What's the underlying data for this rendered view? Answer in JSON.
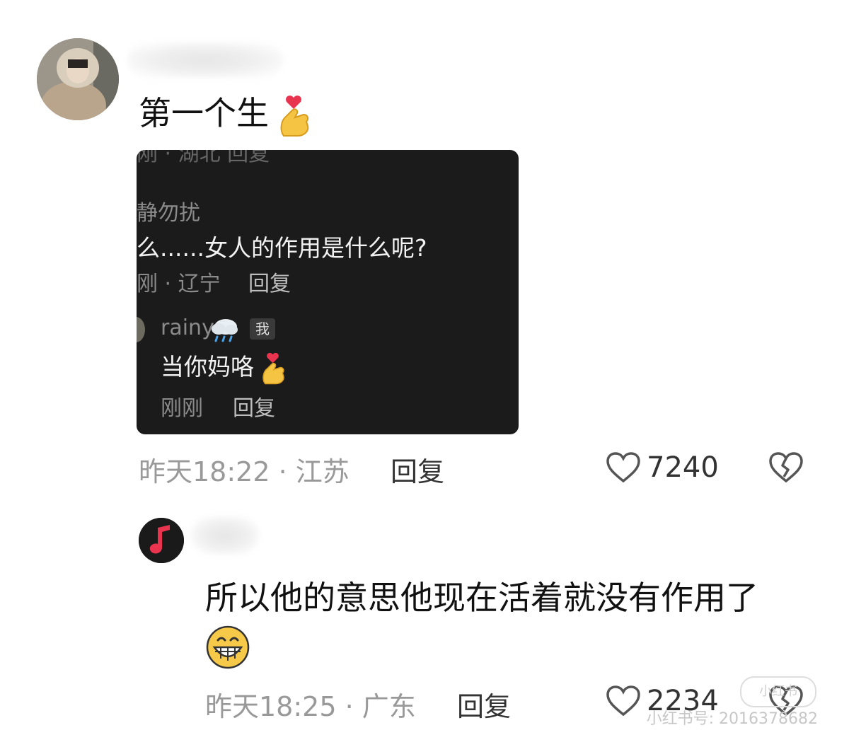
{
  "comment1": {
    "text": "第一个生",
    "time_location": "昨天18:22 · 江苏",
    "reply_label": "回复",
    "like_count": "7240"
  },
  "embedded": {
    "cut_text": "刚 · 湖北    回复",
    "name_partial": "静勿扰",
    "question": "么......女人的作用是什么呢?",
    "time_location": "刚 · 辽宁",
    "reply_label": "回复",
    "reply_user": "rainy",
    "me_badge": "我",
    "reply_text": "当你妈咯",
    "reply_time": "刚刚",
    "reply_reply_label": "回复"
  },
  "comment2": {
    "text": "所以他的意思他现在活着就没有作用了",
    "time_location": "昨天18:25 · 广东",
    "reply_label": "回复",
    "like_count": "2234"
  },
  "watermark": {
    "logo": "小红书",
    "id_text": "小红书号: 2016378682"
  },
  "colors": {
    "accent_red": "#e8344f",
    "dark_panel": "#1b1b1b"
  }
}
